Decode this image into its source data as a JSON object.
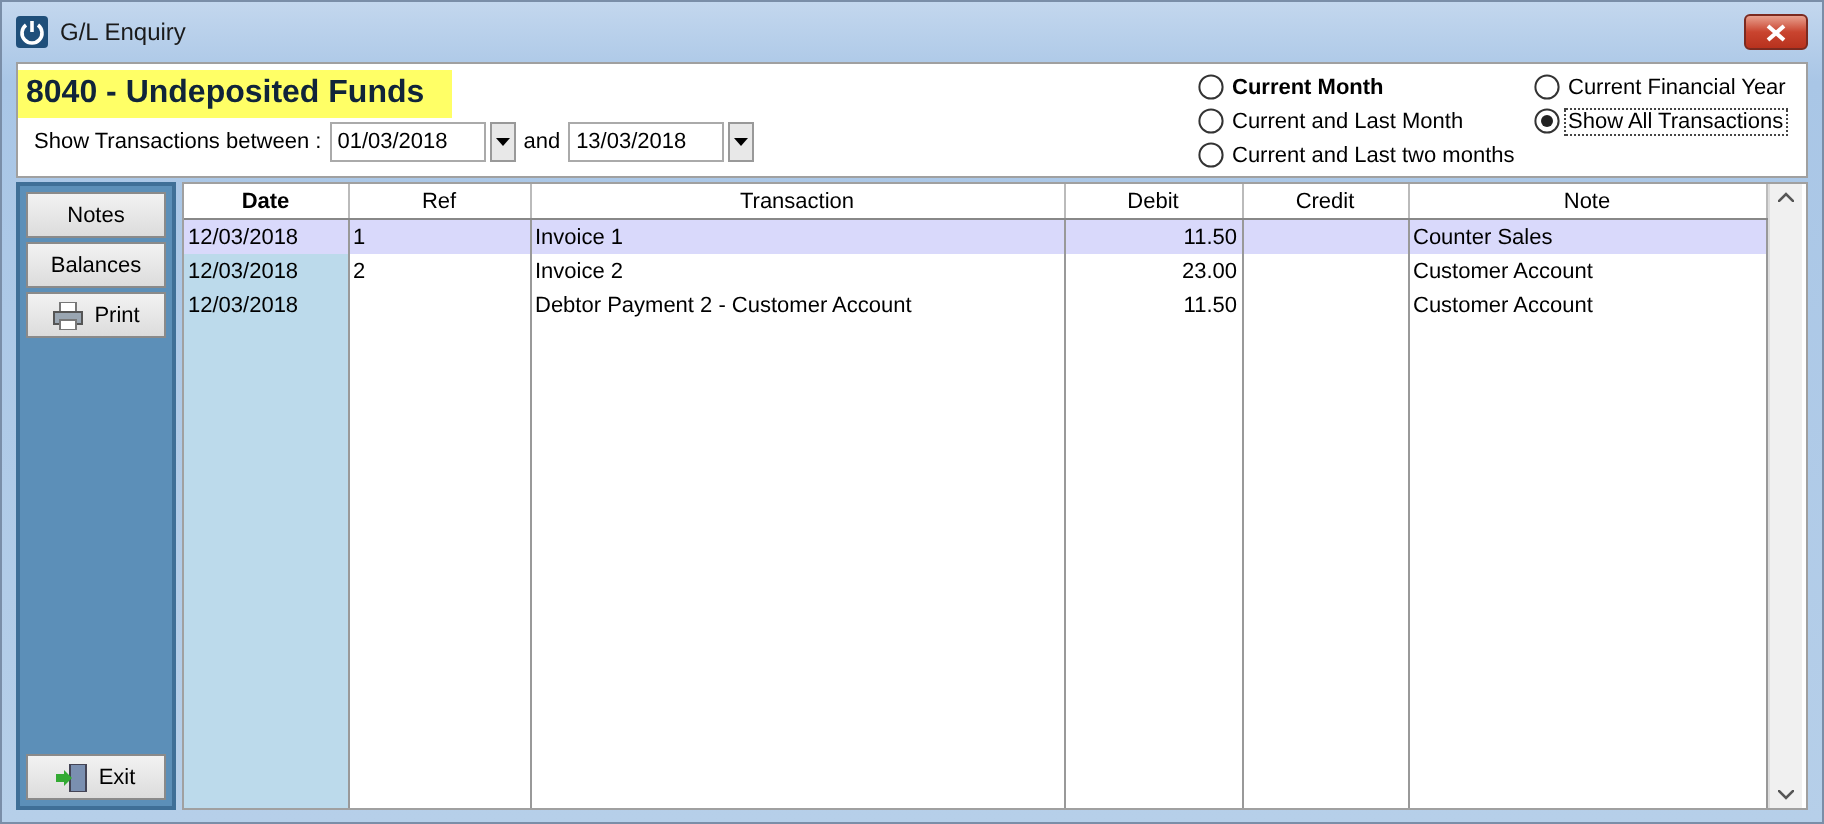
{
  "window": {
    "title": "G/L Enquiry"
  },
  "account": {
    "title": "8040 - Undeposited Funds"
  },
  "filter": {
    "label": "Show Transactions between :",
    "from": "01/03/2018",
    "and_label": "and",
    "to": "13/03/2018"
  },
  "periods": [
    {
      "label": "Current Month",
      "selected": false,
      "bold": true
    },
    {
      "label": "Current and Last Month",
      "selected": false,
      "bold": false
    },
    {
      "label": "Current and Last two months",
      "selected": false,
      "bold": false
    },
    {
      "label": "Current Financial Year",
      "selected": false,
      "bold": false
    },
    {
      "label": "Show All Transactions",
      "selected": true,
      "bold": false
    }
  ],
  "sidebar": {
    "buttons": [
      {
        "label": "Notes",
        "kind": "plain"
      },
      {
        "label": "Balances",
        "kind": "plain"
      },
      {
        "label": "Print",
        "kind": "print"
      }
    ],
    "exit": {
      "label": "Exit"
    }
  },
  "table": {
    "columns": [
      {
        "label": "Date"
      },
      {
        "label": "Ref"
      },
      {
        "label": "Transaction"
      },
      {
        "label": "Debit"
      },
      {
        "label": "Credit"
      },
      {
        "label": "Note"
      }
    ],
    "rows": [
      {
        "cells": [
          "12/03/2018",
          "1",
          "Invoice 1",
          "11.50",
          "",
          "Counter Sales"
        ],
        "selected": true
      },
      {
        "cells": [
          "12/03/2018",
          "2",
          "Invoice 2",
          "23.00",
          "",
          "Customer Account"
        ],
        "selected": false
      },
      {
        "cells": [
          "12/03/2018",
          "",
          "Debtor Payment 2 - Customer Account",
          "11.50",
          "",
          "Customer Account"
        ],
        "selected": false
      }
    ]
  }
}
